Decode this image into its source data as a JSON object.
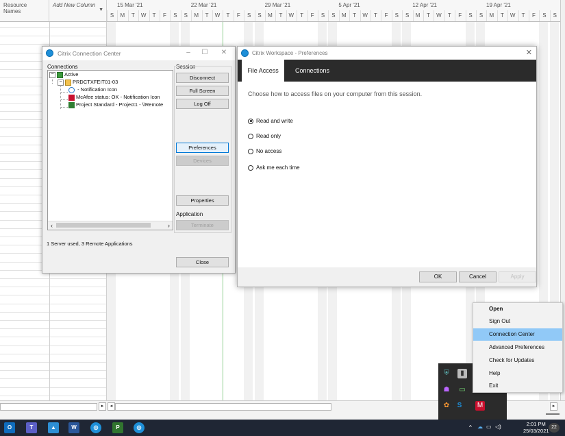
{
  "gantt": {
    "col_names": "Resource Names",
    "col_add": "Add New Column",
    "weeks": [
      "15 Mar '21",
      "22 Mar '21",
      "29 Mar '21",
      "5 Apr '21",
      "12 Apr '21",
      "19 Apr '21"
    ],
    "days": [
      "S",
      "M",
      "T",
      "W",
      "T",
      "F",
      "S",
      "S",
      "M",
      "T",
      "W",
      "T",
      "F",
      "S",
      "S",
      "M",
      "T",
      "W",
      "T",
      "F",
      "S",
      "S",
      "M",
      "T",
      "W",
      "T",
      "F",
      "S",
      "S",
      "M",
      "T",
      "W",
      "T",
      "F",
      "S",
      "S",
      "M",
      "T",
      "W",
      "T",
      "F",
      "S",
      "S"
    ]
  },
  "connection_center": {
    "title": "Citrix Connection Center",
    "connections_label": "Connections",
    "session_label": "Session",
    "application_label": "Application",
    "tree": {
      "root": "Active",
      "server": "PRDCTXFEIT01-03",
      "apps": [
        " - Notification Icon",
        "McAfee status: OK - Notification Icon",
        "Project Standard - Project1 - \\\\Remote"
      ]
    },
    "buttons": {
      "disconnect": "Disconnect",
      "full_screen": "Full Screen",
      "log_off": "Log Off",
      "preferences": "Preferences",
      "devices": "Devices",
      "properties": "Properties",
      "terminate": "Terminate",
      "close": "Close"
    },
    "status": "1 Server used, 3 Remote Applications"
  },
  "preferences": {
    "title": "Citrix Workspace - Preferences",
    "tabs": [
      "File Access",
      "Connections"
    ],
    "active_tab": "File Access",
    "description": "Choose how to access files on your computer from this session.",
    "options": [
      "Read and write",
      "Read only",
      "No access",
      "Ask me each time"
    ],
    "selected_option": "Read and write",
    "buttons": {
      "ok": "OK",
      "cancel": "Cancel",
      "apply": "Apply"
    }
  },
  "context_menu": {
    "items": [
      "Open",
      "Sign Out",
      "Connection Center",
      "Advanced Preferences",
      "Check for Updates",
      "Help",
      "Exit"
    ],
    "bold_item": "Open",
    "highlighted_item": "Connection Center"
  },
  "taskbar": {
    "time": "2:01 PM",
    "date": "25/03/2021",
    "notifications": "22"
  },
  "colors": {
    "taskbar": "#1f2634",
    "tab_bar": "#2b2b2b",
    "menu_highlight": "#91c9f7",
    "citrix_blue": "#1e8fd8"
  }
}
